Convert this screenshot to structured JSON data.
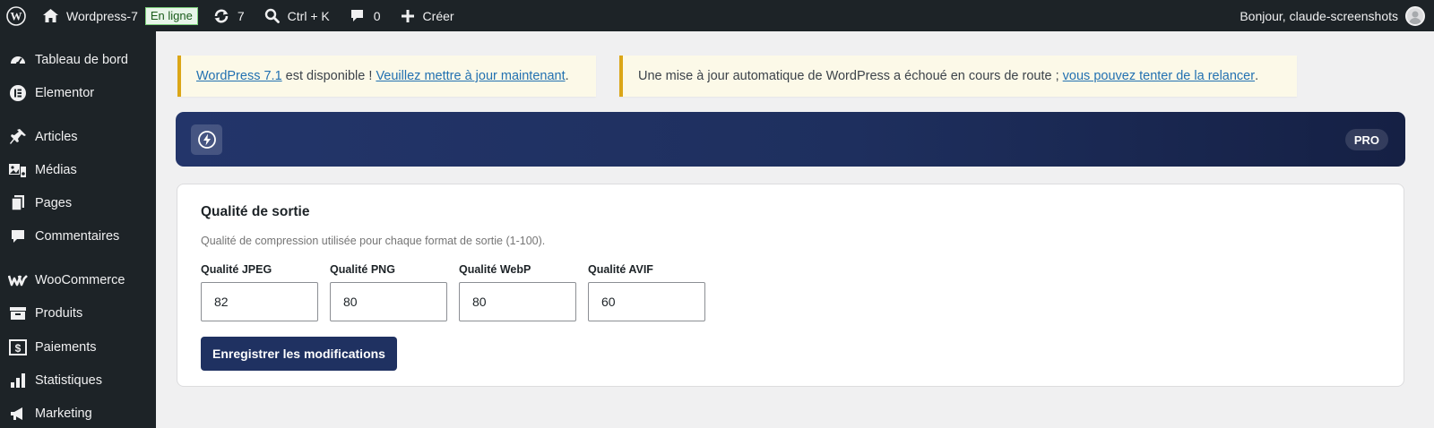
{
  "adminbar": {
    "site_name": "Wordpress-7",
    "status_badge": "En ligne",
    "updates_count": "7",
    "search_shortcut": "Ctrl + K",
    "comments_count": "0",
    "create_label": "Créer",
    "greeting": "Bonjour, claude-screenshots"
  },
  "sidebar": {
    "items": [
      {
        "label": "Tableau de bord",
        "icon": "dashboard-icon"
      },
      {
        "label": "Elementor",
        "icon": "elementor-icon"
      },
      {
        "label": "Articles",
        "icon": "pin-icon"
      },
      {
        "label": "Médias",
        "icon": "media-icon"
      },
      {
        "label": "Pages",
        "icon": "pages-icon"
      },
      {
        "label": "Commentaires",
        "icon": "comment-icon"
      },
      {
        "label": "WooCommerce",
        "icon": "woocommerce-icon"
      },
      {
        "label": "Produits",
        "icon": "archive-icon"
      },
      {
        "label": "Paiements",
        "icon": "dollar-icon"
      },
      {
        "label": "Statistiques",
        "icon": "bar-chart-icon"
      },
      {
        "label": "Marketing",
        "icon": "megaphone-icon"
      }
    ]
  },
  "notices": {
    "update": {
      "link_version": "WordPress 7.1",
      "text_middle": " est disponible ! ",
      "link_update": "Veuillez mettre à jour maintenant",
      "text_end": "."
    },
    "autoupdate": {
      "text": "Une mise à jour automatique de WordPress a échoué en cours de route ; ",
      "link": "vous pouvez tenter de la relancer",
      "text_end": "."
    }
  },
  "banner": {
    "pro_label": "PRO"
  },
  "quality": {
    "title": "Qualité de sortie",
    "description": "Qualité de compression utilisée pour chaque format de sortie (1-100).",
    "fields": [
      {
        "label": "Qualité JPEG",
        "value": "82"
      },
      {
        "label": "Qualité PNG",
        "value": "80"
      },
      {
        "label": "Qualité WebP",
        "value": "80"
      },
      {
        "label": "Qualité AVIF",
        "value": "60"
      }
    ],
    "save_label": "Enregistrer les modifications"
  },
  "colors": {
    "adminbar_bg": "#1d2327",
    "banner_navy": "#1e2f5e",
    "notice_border": "#dba617",
    "link": "#2271b1"
  }
}
